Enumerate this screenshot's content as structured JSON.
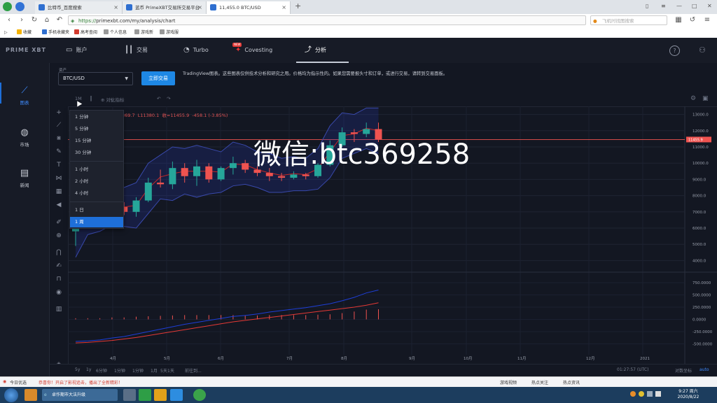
{
  "browser": {
    "tabs": [
      {
        "title": "比特币_百度搜索",
        "active": false,
        "color": "#2f6fd0"
      },
      {
        "title": "蓝币 PrimeXBT交易所交易平台",
        "active": false,
        "color": "#2f6fd0"
      },
      {
        "title": "11,455.0 BTC/USD",
        "active": true,
        "color": "#2f6fd0"
      }
    ],
    "new_tab": "+",
    "url_secure": "https://",
    "url_rest": "primexbt.com/my/analysis/chart",
    "search_placeholder": "飞机时找图搜索",
    "bookmarks": [
      "收藏",
      "手机收藏夹",
      "高考查阅",
      "个人信息",
      "游戏新",
      "游戏服"
    ]
  },
  "app": {
    "logo": "PRIME XBT",
    "nav": [
      {
        "label": "账户",
        "icon": "wallet-icon"
      },
      {
        "label": "交易",
        "icon": "candles-icon"
      },
      {
        "label": "Turbo",
        "icon": "speed-icon"
      },
      {
        "label": "Covesting",
        "icon": "covesting-icon",
        "badge": "NEW"
      },
      {
        "label": "分析",
        "icon": "analysis-icon"
      }
    ],
    "help_icon": "?",
    "sidebar": [
      {
        "label": "图表",
        "icon": "chart-line-icon",
        "active": true
      },
      {
        "label": "市场",
        "icon": "globe-icon",
        "active": false
      },
      {
        "label": "新闻",
        "icon": "news-icon",
        "active": false
      }
    ],
    "asset_label": "资产",
    "asset_value": "BTC/USD",
    "trade_button": "立即交易",
    "disclaimer": "TradingView图表。这些图表仅供技术分析和研究之用。价格均为指示性的。如果您需要报头寸和订单，或进行交易，请转到交易面板。",
    "toolbar": {
      "indicators": "指标",
      "compare": "对比",
      "interval": "1M"
    },
    "ohlc": "369.7  L11380.1  收=11455.9  -458.1 (-3.85%)",
    "watermark": "微信:btc369258"
  },
  "interval_menu": {
    "items": [
      "1 分钟",
      "5 分钟",
      "15 分钟",
      "30 分钟",
      "1 小时",
      "2 小时",
      "4 小时",
      "1 日",
      "1 周"
    ],
    "selected": "1 周"
  },
  "chart_data": {
    "type": "candlestick",
    "price_axis": [
      "13000.0",
      "12000.0",
      "11000.0",
      "10000.0",
      "9000.0",
      "8000.0",
      "7000.0",
      "6000.0",
      "5000.0",
      "4000.0"
    ],
    "current_price": "11455.9",
    "ylim": [
      3500,
      13500
    ],
    "indicator_axis": [
      "750.0000",
      "500.0000",
      "250.0000",
      "0.0000",
      "-250.0000",
      "-500.0000"
    ],
    "months": [
      "4月",
      "5月",
      "6月",
      "7月",
      "8月",
      "9月",
      "10月",
      "11月",
      "12月",
      "2021"
    ],
    "candles": [
      {
        "o": 5800,
        "c": 6600,
        "h": 6800,
        "l": 4900
      },
      {
        "o": 6600,
        "c": 6700,
        "h": 7200,
        "l": 6300
      },
      {
        "o": 6700,
        "c": 7200,
        "h": 7500,
        "l": 6500
      },
      {
        "o": 7200,
        "c": 7300,
        "h": 7700,
        "l": 6900
      },
      {
        "o": 7300,
        "c": 7000,
        "h": 7600,
        "l": 6800
      },
      {
        "o": 7000,
        "c": 7700,
        "h": 7900,
        "l": 6700
      },
      {
        "o": 7700,
        "c": 8800,
        "h": 9100,
        "l": 7600
      },
      {
        "o": 8800,
        "c": 8700,
        "h": 9600,
        "l": 8500
      },
      {
        "o": 8700,
        "c": 9700,
        "h": 10100,
        "l": 8400
      },
      {
        "o": 9700,
        "c": 9200,
        "h": 10000,
        "l": 8800
      },
      {
        "o": 9200,
        "c": 9800,
        "h": 10200,
        "l": 8600
      },
      {
        "o": 9800,
        "c": 9000,
        "h": 10000,
        "l": 8800
      },
      {
        "o": 9000,
        "c": 9700,
        "h": 9800,
        "l": 8900
      },
      {
        "o": 9700,
        "c": 10000,
        "h": 10400,
        "l": 9300
      },
      {
        "o": 10000,
        "c": 9600,
        "h": 10200,
        "l": 9400
      },
      {
        "o": 9600,
        "c": 9400,
        "h": 9800,
        "l": 9200
      },
      {
        "o": 9400,
        "c": 9200,
        "h": 9700,
        "l": 8900
      },
      {
        "o": 9200,
        "c": 9100,
        "h": 9400,
        "l": 8900
      },
      {
        "o": 9100,
        "c": 9300,
        "h": 9500,
        "l": 9000
      },
      {
        "o": 9300,
        "c": 9200,
        "h": 9400,
        "l": 9000
      },
      {
        "o": 9200,
        "c": 9900,
        "h": 10000,
        "l": 9100
      },
      {
        "o": 9900,
        "c": 11100,
        "h": 11400,
        "l": 9800
      },
      {
        "o": 11100,
        "c": 11900,
        "h": 12200,
        "l": 11000
      },
      {
        "o": 11900,
        "c": 11800,
        "h": 12100,
        "l": 11300
      },
      {
        "o": 11800,
        "c": 12100,
        "h": 12500,
        "l": 11600
      },
      {
        "o": 12100,
        "c": 11455,
        "h": 12500,
        "l": 11300
      }
    ],
    "indicator_line1": [
      -450,
      -440,
      -420,
      -380,
      -350,
      -300,
      -250,
      -200,
      -150,
      -100,
      -60,
      -20,
      20,
      60,
      80,
      110,
      150,
      180,
      210,
      240,
      280,
      320,
      380,
      450,
      540,
      600
    ],
    "indicator_line2": [
      -480,
      -470,
      -450,
      -430,
      -400,
      -370,
      -330,
      -290,
      -250,
      -210,
      -170,
      -130,
      -90,
      -50,
      -20,
      10,
      40,
      70,
      100,
      130,
      160,
      190,
      220,
      250,
      290,
      340
    ]
  },
  "bottom_bar": {
    "intervals": [
      "5y",
      "1y",
      "6分钟",
      "1分钟",
      "1分钟",
      "1月",
      "5天",
      "1天"
    ],
    "goto": "前往到...",
    "time": "01:27:57 (UTC)",
    "log": "对数坐标",
    "auto": "auto"
  },
  "news_bar": {
    "left": "今日优选",
    "ticker": "恭喜你！开启了影视追击，播出了全新精彩！",
    "items": [
      "游戏视频",
      "热点关注",
      "热点资讯"
    ]
  },
  "taskbar": {
    "active_window": "卓作期市大法升级",
    "time": "9:27 周六",
    "date": "2020/8/22"
  }
}
